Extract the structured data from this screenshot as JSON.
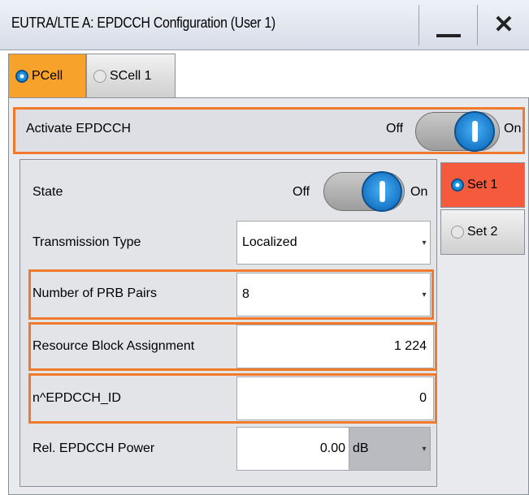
{
  "window": {
    "title": "EUTRA/LTE A: EPDCCH Configuration (User 1)"
  },
  "tabs": [
    {
      "label": "PCell"
    },
    {
      "label": "SCell 1"
    }
  ],
  "activate": {
    "label": "Activate EPDCCH",
    "off_label": "Off",
    "on_label": "On",
    "state": "On"
  },
  "state": {
    "label": "State",
    "off_label": "Off",
    "on_label": "On",
    "value": "On"
  },
  "transmission_type": {
    "label": "Transmission Type",
    "value": "Localized"
  },
  "prb_pairs": {
    "label": "Number of PRB Pairs",
    "value": "8"
  },
  "rb_assignment": {
    "label": "Resource Block Assignment",
    "value": "1 224"
  },
  "epdcch_id": {
    "label": "n^EPDCCH_ID",
    "value": "0"
  },
  "power": {
    "label": "Rel. EPDCCH Power",
    "value": "0.00",
    "unit": "dB"
  },
  "sets": [
    {
      "label": "Set 1"
    },
    {
      "label": "Set 2"
    }
  ],
  "colors": {
    "tab_active": "#f7a22b",
    "highlight": "#ef7a2b",
    "set_active": "#f55a3c",
    "toggle_blue": "#1a8fe0"
  }
}
